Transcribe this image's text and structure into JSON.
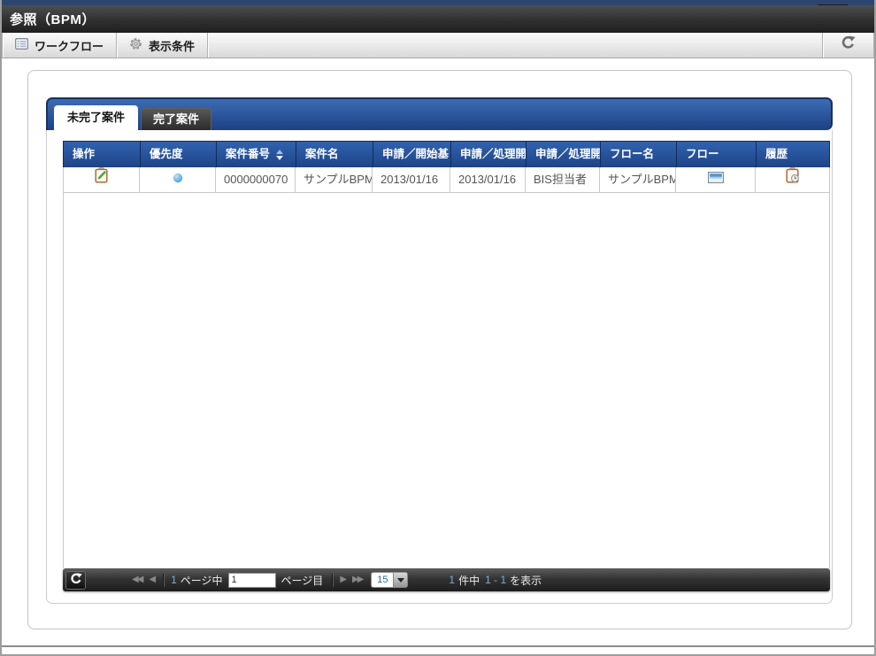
{
  "window": {
    "title": "参照（BPM）"
  },
  "toolbar": {
    "buttons": [
      {
        "label": "ワークフロー"
      },
      {
        "label": "表示条件"
      }
    ]
  },
  "tabs": {
    "items": [
      {
        "label": "未完了案件",
        "active": true
      },
      {
        "label": "完了案件",
        "active": false
      }
    ]
  },
  "table": {
    "headers": [
      "操作",
      "優先度",
      "案件番号",
      "案件名",
      "申請／開始基",
      "申請／処理開",
      "申請／処理開",
      "フロー名",
      "フロー",
      "履歴"
    ],
    "sorted_column": "案件番号",
    "rows": [
      {
        "case_number": "0000000070",
        "case_name": "サンプルBPM",
        "request_start_date": "2013/01/16",
        "request_process_date": "2013/01/16",
        "request_processor": "BIS担当者",
        "flow_name": "サンプルBPM"
      }
    ]
  },
  "pagination": {
    "total_pages": "1",
    "pages_label": "ページ中",
    "current_page": "1",
    "page_suffix_label": "ページ目",
    "page_size": "15",
    "info": {
      "total": "1",
      "total_label": "件中",
      "range": "1 - 1",
      "suffix_label": "を表示"
    }
  },
  "icons": {
    "workflow": "list-icon",
    "display_condition": "gear-icon",
    "reload": "refresh-icon",
    "operation": "clipboard-edit-icon",
    "priority": "blue-dot",
    "flow": "image-icon",
    "history": "clipboard-clock-icon"
  },
  "colors": {
    "header_blue_top": "#3263ae",
    "header_blue_bottom": "#1f4486",
    "tabstrip_border": "#17325f",
    "pagination_accent_blue": "#74afe0",
    "priority_dot": "#55a7da",
    "titlebar_strip": "#2b4570"
  }
}
